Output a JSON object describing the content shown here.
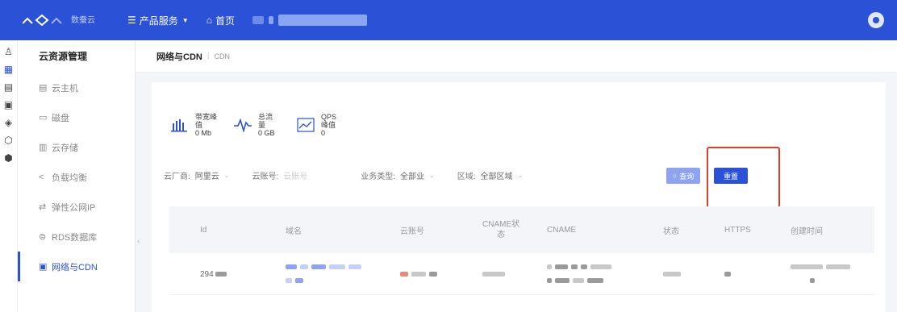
{
  "topbar": {
    "brand_text": "数蚕云",
    "nav": [
      {
        "label": "产品服务",
        "icon": "grid-menu-icon"
      },
      {
        "label": "首页",
        "icon": "home-icon"
      }
    ]
  },
  "sidebar": {
    "title": "云资源管理",
    "items": [
      {
        "label": "云主机",
        "icon": "server-icon"
      },
      {
        "label": "磁盘",
        "icon": "disk-icon"
      },
      {
        "label": "云存储",
        "icon": "storage-icon"
      },
      {
        "label": "负载均衡",
        "icon": "share-icon"
      },
      {
        "label": "弹性公网IP",
        "icon": "swap-icon"
      },
      {
        "label": "RDS数据库",
        "icon": "database-icon"
      },
      {
        "label": "网络与CDN",
        "icon": "network-icon",
        "active": true
      }
    ]
  },
  "breadcrumb": {
    "main": "网络与CDN",
    "sep": "|",
    "sub": "CDN"
  },
  "stats": [
    {
      "label1": "带宽峰",
      "label2": "值",
      "value": "0 Mb",
      "icon": "bar-chart-icon"
    },
    {
      "label1": "总流",
      "label2": "量",
      "value": "0 GB",
      "icon": "pulse-icon"
    },
    {
      "label1": "QPS",
      "label2": "峰值",
      "value": "0",
      "icon": "area-chart-icon"
    }
  ],
  "filters": {
    "vendor_label": "云厂商:",
    "vendor_value": "阿里云",
    "account_label": "云账号:",
    "account_placeholder": "云账号",
    "biztype_label": "业务类型:",
    "biztype_value": "全部业",
    "region_label": "区域:",
    "region_value": "全部区域"
  },
  "buttons": {
    "query": "查询",
    "reset": "重置"
  },
  "table": {
    "columns": [
      "Id",
      "域名",
      "云账号",
      "CNAME状态",
      "CNAME",
      "状态",
      "HTTPS",
      "创建时间"
    ],
    "cname_status_line1": "CNAME状",
    "cname_status_line2": "态",
    "row": {
      "id": "294"
    }
  },
  "colors": {
    "primary": "#2a51d6",
    "highlight": "#e0412f"
  }
}
